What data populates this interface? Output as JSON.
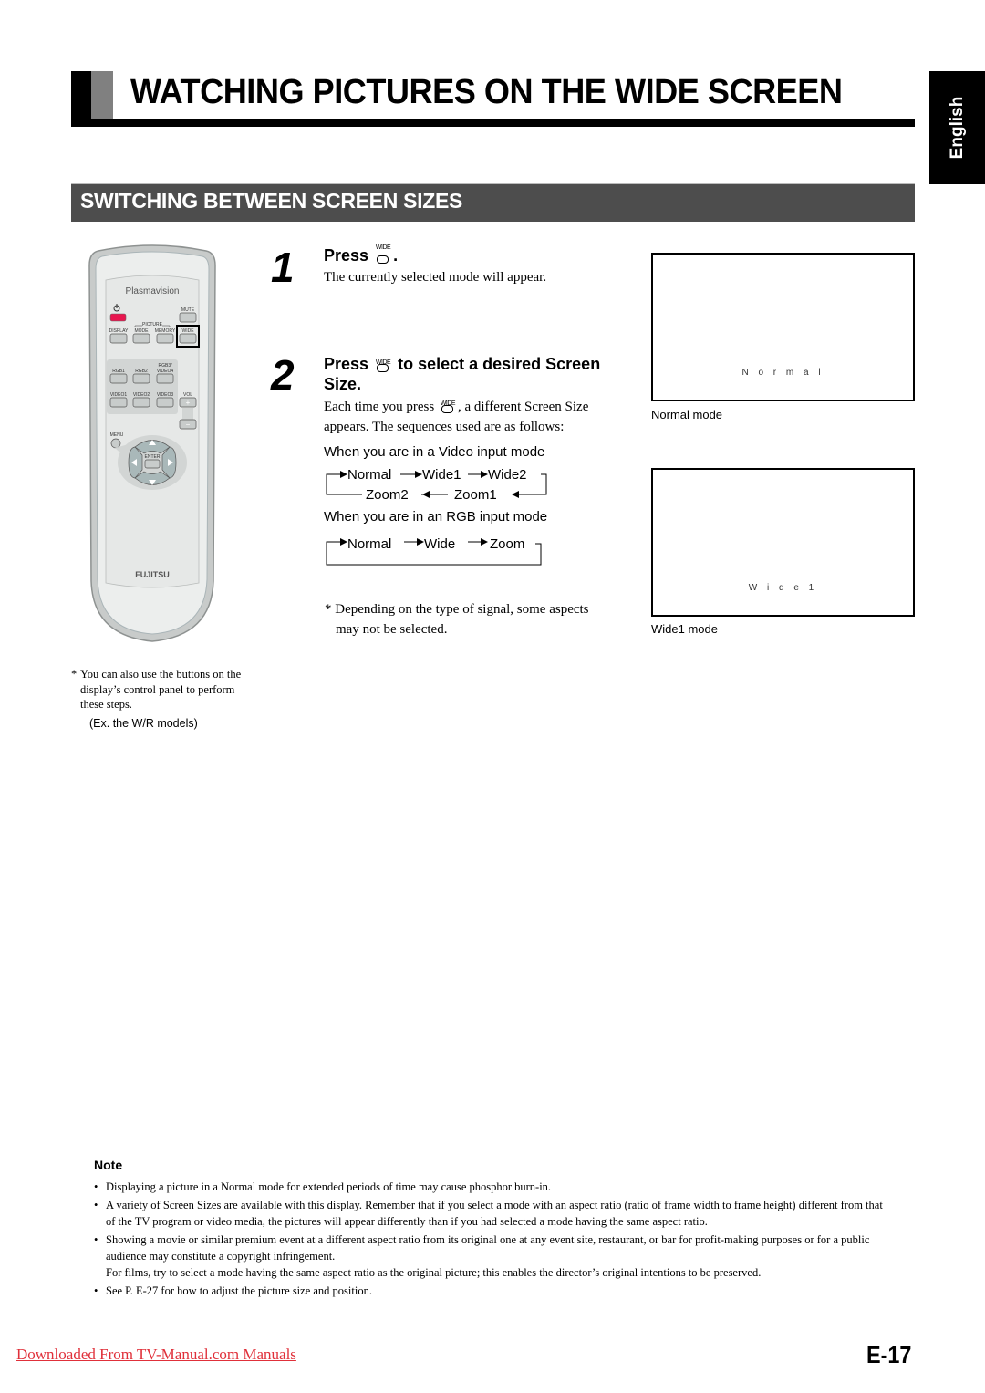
{
  "page": {
    "title": "WATCHING PICTURES ON THE WIDE SCREEN",
    "language_tab": "English",
    "section_title": "SWITCHING BETWEEN SCREEN SIZES",
    "page_number": "E-17",
    "footer_link": "Downloaded From TV-Manual.com Manuals"
  },
  "remote": {
    "brand_top": "Plasmavision",
    "brand_bottom": "FUJITSU",
    "buttons": {
      "power_icon": "power-icon",
      "mute": "MUTE",
      "picture_group": "PICTURE",
      "display": "DISPLAY",
      "mode": "MODE",
      "memory": "MEMORY",
      "wide": "WIDE",
      "rgb1": "RGB1",
      "rgb2": "RGB2",
      "rgb3_line1": "RGB3/",
      "rgb3_line2": "VIDEO4",
      "video1": "VIDEO1",
      "video2": "VIDEO2",
      "video3": "VIDEO3",
      "vol": "VOL",
      "vol_up": "+",
      "vol_down": "−",
      "menu": "MENU",
      "enter": "ENTER"
    },
    "colors": {
      "power_button": "#e8164f",
      "body": "#e9ebea",
      "outline": "#9fa3a2"
    },
    "note_star": "*",
    "note": "You can also use the buttons on the display’s control panel to perform these steps.",
    "example": "(Ex. the W/R models)"
  },
  "steps": [
    {
      "number": "1",
      "heading_pre": "Press",
      "button_label": "WIDE",
      "heading_post": ".",
      "body": "The currently selected mode will appear."
    },
    {
      "number": "2",
      "heading_pre": "Press",
      "button_label": "WIDE",
      "heading_post": "to select a desired Screen",
      "heading_line2": "Size.",
      "body_pre": "Each time you press",
      "body_post": ", a different Screen Size",
      "body_line2": "appears.  The sequences used are as follows:"
    }
  ],
  "sequences": {
    "video_label": "When you are in a Video input mode",
    "video_row1": [
      "Normal",
      "Wide1",
      "Wide2"
    ],
    "video_row2": [
      "Zoom2",
      "Zoom1"
    ],
    "rgb_label": "When you are in an RGB input mode",
    "rgb_row": [
      "Normal",
      "Wide",
      "Zoom"
    ]
  },
  "signal_note": {
    "star": "*",
    "line1": "Depending on the type of signal, some aspects",
    "line2": "may not be selected."
  },
  "screens": [
    {
      "inner_label": "N o r m a l",
      "caption": "Normal mode"
    },
    {
      "inner_label": "W i d e 1",
      "caption": "Wide1 mode"
    }
  ],
  "note": {
    "heading": "Note",
    "bullet": "•",
    "items": [
      "Displaying a picture in a Normal mode for extended periods of time may cause phosphor burn-in.",
      "A variety of Screen Sizes are available with this display.  Remember that if you select a mode with an aspect ratio (ratio of frame width to frame height) different from that of the TV program or video media, the pictures will appear differently than if you had selected a mode having the same aspect ratio.",
      "Showing a movie or similar premium event at a different aspect ratio from its original one at any event site, restaurant, or bar for profit-making purposes or for a public audience may constitute a copyright infringement.",
      "See P. E-27 for how to adjust the picture size and position."
    ],
    "item3_extra": "For films, try to select a mode having the same aspect ratio as the original picture; this enables the director’s original intentions to be preserved."
  }
}
